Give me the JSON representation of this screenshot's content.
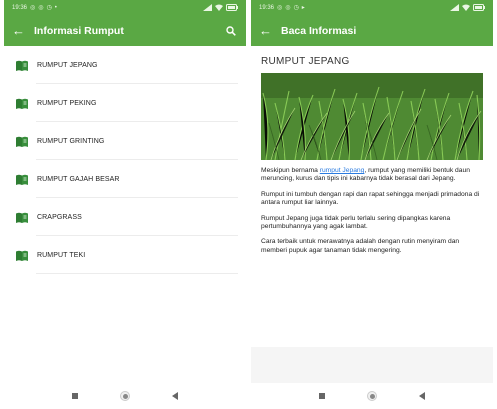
{
  "left_screen": {
    "status": {
      "time": "19:36"
    },
    "appbar": {
      "back_symbol": "←",
      "title": "Informasi Rumput"
    },
    "items": [
      {
        "label": "RUMPUT JEPANG"
      },
      {
        "label": "RUMPUT PEKING"
      },
      {
        "label": "RUMPUT GRINTING"
      },
      {
        "label": "RUMPUT GAJAH BESAR"
      },
      {
        "label": "CRAPGRASS"
      },
      {
        "label": "RUMPUT TEKI"
      }
    ]
  },
  "right_screen": {
    "status": {
      "time": "19:36"
    },
    "appbar": {
      "back_symbol": "←",
      "title": "Baca Informasi"
    },
    "article": {
      "title": "RUMPUT JEPANG",
      "p1_before": "Meskipun bernama ",
      "p1_link": "rumput Jepang",
      "p1_after": ", rumput yang memiliki bentuk daun meruncing, kurus dan tipis ini kabarnya tidak berasal dari Jepang.",
      "p2": "Rumput ini tumbuh dengan rapi dan rapat sehingga menjadi primadona di antara rumput liar lainnya.",
      "p3": "Rumput Jepang juga tidak perlu terlalu sering dipangkas karena pertumbuhannya yang agak lambat.",
      "p4": "Cara terbaik untuk merawatnya adalah dengan rutin menyiram dan memberi pupuk agar tanaman tidak mengering."
    }
  },
  "colors": {
    "primary": "#5aa844",
    "book_icon": "#2e7d32",
    "link": "#2b7be0"
  }
}
